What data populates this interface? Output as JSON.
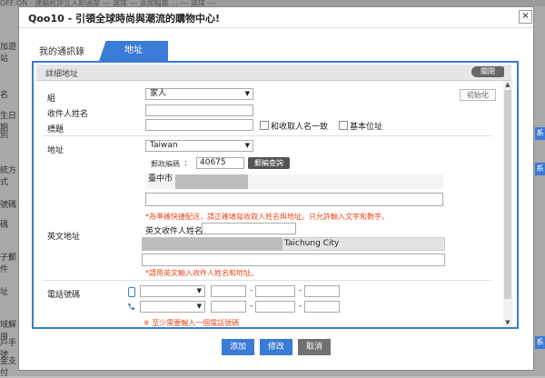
{
  "background": {
    "top_strip": "OFF   ON - 連續死評立人卸過家   --- 選擇 ---           添加帽鑑 ...   --- 選擇 ---",
    "left_labels": [
      "加遊站",
      "名",
      "生日期",
      "別",
      "統方式",
      "號碼",
      "碼",
      "子郵件",
      "址",
      "域解用",
      "戶手號",
      "金支付"
    ],
    "right_tabs": [
      "系",
      "系",
      "系"
    ]
  },
  "modal": {
    "title": "Qoo10 - 引領全球時尚與潮流的購物中心!",
    "close": "×",
    "tabs": [
      "我的通訊錄",
      "地址"
    ],
    "panel_title": "詳細地址",
    "close_button": "關閉",
    "labels": {
      "group": "組",
      "recipient_name": "收件人姓名",
      "heading": "標題",
      "address": "地址",
      "english_address": "英文地址",
      "phone": "電話號碼"
    },
    "group_value": "家人",
    "reset_button": "初始化",
    "same_as_recipient": "和收取人名一致",
    "basic_location": "基本位址",
    "country_value": "Taiwan",
    "postal_code_label": "郵政編碼",
    "postal_colon": ":",
    "postal_code": "40675",
    "postal_search": "郵編查詢",
    "city_prefix": "臺中市",
    "address_warning": "*為準確快捷配送，請正確填寫收取人姓名與地址。只允許輸入文字和數字。",
    "english_recipient_label": "英文收件人姓名",
    "english_city": "Taichung City",
    "english_warning": "*請用英文輸入收件人姓名和地址。",
    "phone_warning": "※ 至少需要輸入一個電話號碼",
    "dash": "-",
    "scroll_up": "▲",
    "scroll_down": "▼",
    "dropdown_arrow": "▼"
  },
  "footer": {
    "add": "添加",
    "edit": "修改",
    "cancel": "取消"
  },
  "colors": {
    "accent": "#3a7bd5",
    "warning": "#e84a1c",
    "add_button": "#3a7bd5",
    "edit_button": "#3a7bd5",
    "cancel_button": "#707070"
  }
}
